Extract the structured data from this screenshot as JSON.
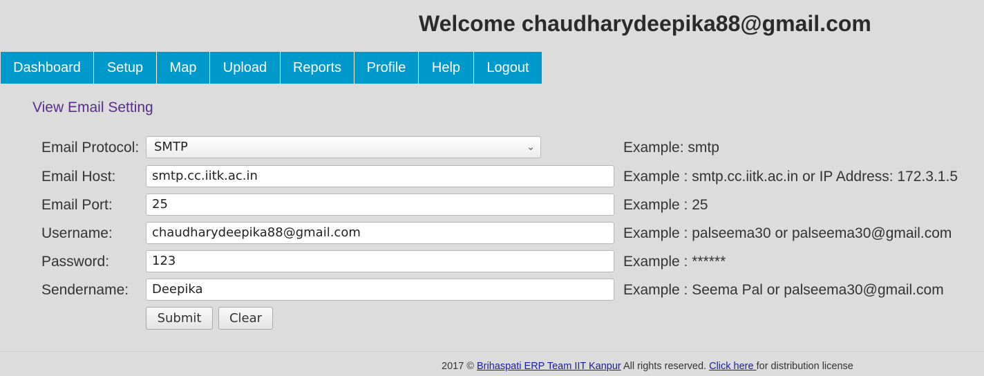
{
  "header": {
    "welcome_text": "Welcome chaudharydeepika88@gmail.com"
  },
  "nav": {
    "items": [
      {
        "label": "Dashboard"
      },
      {
        "label": "Setup"
      },
      {
        "label": "Map"
      },
      {
        "label": "Upload"
      },
      {
        "label": "Reports"
      },
      {
        "label": "Profile"
      },
      {
        "label": "Help"
      },
      {
        "label": "Logout"
      }
    ]
  },
  "page": {
    "title": "View Email Setting"
  },
  "form": {
    "protocol": {
      "label": "Email Protocol:",
      "value": "SMTP",
      "example": "Example: smtp"
    },
    "host": {
      "label": "Email Host:",
      "value": "smtp.cc.iitk.ac.in",
      "example": "Example : smtp.cc.iitk.ac.in or IP Address: 172.3.1.5"
    },
    "port": {
      "label": "Email Port:",
      "value": "25",
      "example": "Example : 25"
    },
    "username": {
      "label": "Username:",
      "value": "chaudharydeepika88@gmail.com",
      "example": "Example : palseema30 or palseema30@gmail.com"
    },
    "password": {
      "label": "Password:",
      "value": "123",
      "example": "Example : ******"
    },
    "sendername": {
      "label": "Sendername:",
      "value": "Deepika",
      "example": "Example : Seema Pal or palseema30@gmail.com"
    },
    "submit_label": "Submit",
    "clear_label": "Clear"
  },
  "footer": {
    "copyright": "2017 ©",
    "team_link": "Brihaspati ERP Team IIT Kanpur",
    "rights": "All rights reserved.",
    "click_link": "Click here ",
    "license": "for distribution license"
  },
  "colors": {
    "nav_bg": "#0099cc",
    "page_bg": "#dcdcdc",
    "title_color": "#5a2a8c",
    "link_color": "#1a1aa8"
  }
}
